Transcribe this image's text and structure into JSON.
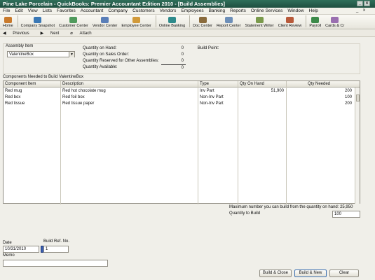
{
  "title": "Pine Lake Porcelain  -  QuickBooks: Premier Accountant Edition 2010 - [Build Assemblies]",
  "menu": [
    "File",
    "Edit",
    "View",
    "Lists",
    "Favorites",
    "Accountant",
    "Company",
    "Customers",
    "Vendors",
    "Employees",
    "Banking",
    "Reports",
    "Online Services",
    "Window",
    "Help"
  ],
  "toolbar": [
    "Home",
    "Company Snapshot",
    "Customer Center",
    "Vendor Center",
    "Employee Center",
    "Online Banking",
    "Doc Center",
    "Report Center",
    "Statement Writer",
    "Client Review",
    "Payroll",
    "Cards & Cr"
  ],
  "nav": {
    "previous": "Previous",
    "next": "Next",
    "attach": "Attach"
  },
  "assembly": {
    "label": "Assembly Item",
    "value": "ValentineBox"
  },
  "quantities": {
    "on_hand_label": "Quantity on Hand:",
    "on_hand": "0",
    "on_sales_label": "Quantity on Sales Order:",
    "on_sales": "0",
    "reserved_label": "Quantity Reserved for Other Assemblies:",
    "reserved": "0",
    "available_label": "Quantity Available:",
    "available": "0"
  },
  "build_point_label": "Build Point:",
  "components_label": "Components Needed to Build  ValentineBox",
  "columns": [
    "Component Item",
    "Description",
    "Type",
    "Qty On Hand",
    "Qty Needed"
  ],
  "rows": [
    {
      "item": "Red mug",
      "desc": "Red hot chocolate mug",
      "type": "Inv Part",
      "onhand": "51,900",
      "needed": "200"
    },
    {
      "item": "Red box",
      "desc": "Red foil box",
      "type": "Non-Inv Part",
      "onhand": "",
      "needed": "100"
    },
    {
      "item": "Red tissue",
      "desc": "Red tissue paper",
      "type": "Non-Inv Part",
      "onhand": "",
      "needed": "200"
    }
  ],
  "max_build": "Maximum number you can build from the quantity on hand: 25,950",
  "qty_to_build_label": "Quantity to Build",
  "qty_to_build": "100",
  "date_label": "Date",
  "date": "10/31/2010",
  "ref_label": "Build Ref. No.",
  "ref": "1",
  "memo_label": "Memo",
  "memo": "",
  "buttons": {
    "build_close": "Build & Close",
    "build_new": "Build & New",
    "clear": "Clear"
  }
}
